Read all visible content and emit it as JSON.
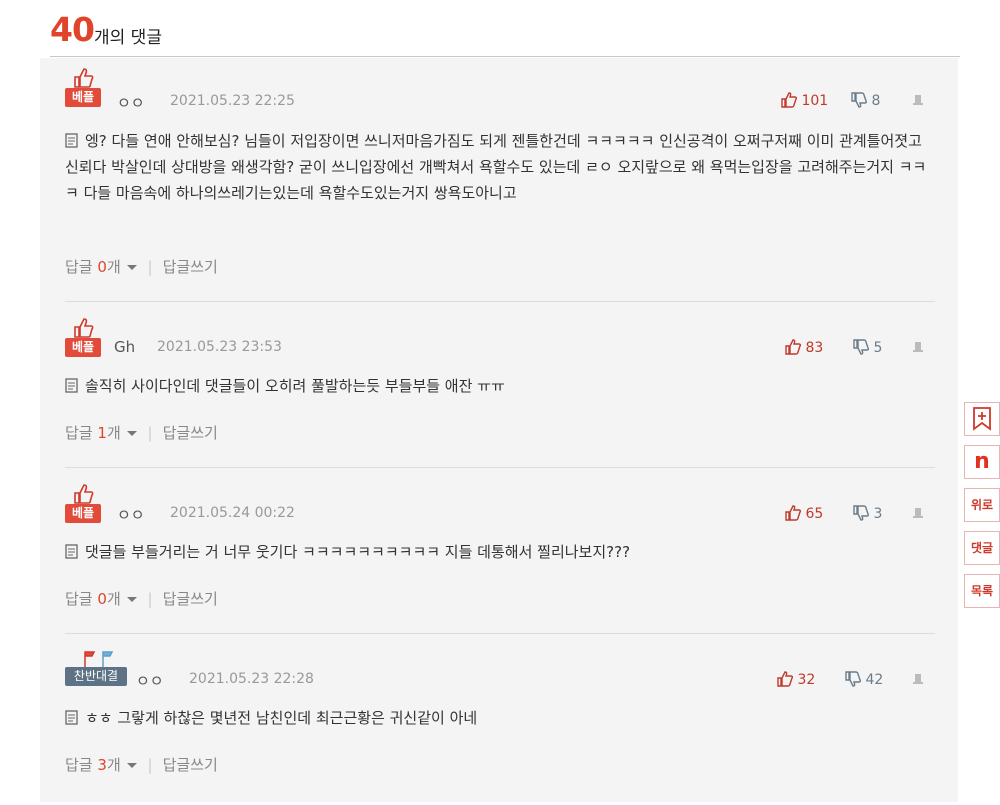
{
  "header": {
    "count": "40",
    "count_label": "개의 댓글"
  },
  "comments": [
    {
      "badge": "베플",
      "author": "ㅇㅇ",
      "date": "2021.05.23 22:25",
      "up": "101",
      "down": "8",
      "text": "엥? 다들 연애 안해보심? 님들이 저입장이면 쓰니저마음가짐도 되게 젠틀한건데 ㅋㅋㅋㅋㅋ 인신공격이 오쩌구저째 이미 관계틀어졋고 신뢰다 박살인데 상대방을 왜생각함? 굳이 쓰니입장에선 개빡쳐서 욕할수도 있는데 ㄹㅇ 오지랖으로 왜 욕먹는입장을 고려해주는거지 ㅋㅋㅋ 다들 마음속에 하나의쓰레기는있는데 욕할수도있는거지 쌍욕도아니고",
      "reply_label": "답글",
      "reply_count": "0",
      "reply_unit": "개",
      "write_label": "답글쓰기"
    },
    {
      "badge": "베플",
      "author": "Gh",
      "date": "2021.05.23 23:53",
      "up": "83",
      "down": "5",
      "text": "솔직히 사이다인데 댓글들이 오히려 풀발하는듯 부들부들 애잔 ㅠㅠ",
      "reply_label": "답글",
      "reply_count": "1",
      "reply_unit": "개",
      "write_label": "답글쓰기"
    },
    {
      "badge": "베플",
      "author": "ㅇㅇ",
      "date": "2021.05.24 00:22",
      "up": "65",
      "down": "3",
      "text": "댓글들 부들거리는 거 너무 웃기다 ㅋㅋㅋㅋㅋㅋㅋㅋㅋㅋ 지들 데통해서 찔리나보지???",
      "reply_label": "답글",
      "reply_count": "0",
      "reply_unit": "개",
      "write_label": "답글쓰기"
    },
    {
      "badge": "찬반대결",
      "author": "ㅇㅇ",
      "date": "2021.05.23 22:28",
      "up": "32",
      "down": "42",
      "text": "ㅎㅎ 그랗게 하찮은 몇년전 남친인데 최근근황은 귀신같이 아네",
      "reply_label": "답글",
      "reply_count": "3",
      "reply_unit": "개",
      "write_label": "답글쓰기"
    }
  ],
  "side": {
    "up_label": "위로",
    "comment_label": "댓글",
    "list_label": "목록",
    "n_label": "n"
  },
  "colors": {
    "accent": "#e0452b",
    "badge_best": "#e24a3a",
    "badge_vs": "#5d7385"
  }
}
